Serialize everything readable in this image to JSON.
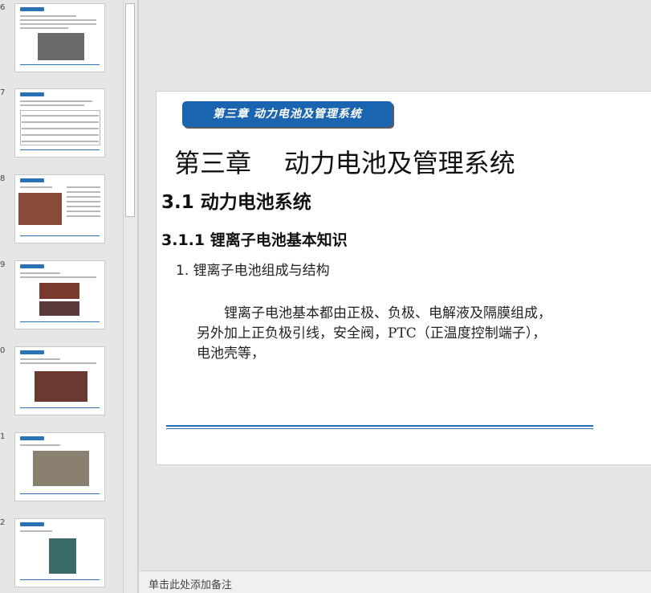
{
  "thumbnails": [
    {
      "number": "6"
    },
    {
      "number": "7"
    },
    {
      "number": "8"
    },
    {
      "number": "9"
    },
    {
      "number": "0"
    },
    {
      "number": "1"
    },
    {
      "number": "2"
    }
  ],
  "slide": {
    "chapter_banner": "第三章  动力电池及管理系统",
    "title": "第三章    动力电池及管理系统",
    "section": "3.1 动力电池系统",
    "subsection": "3.1.1 锂离子电池基本知识",
    "list_item": "1. 锂离子电池组成与结构",
    "body": "锂离子电池基本都由正极、负极、电解液及隔膜组成，另外加上正负极引线，安全阀，PTC（正温度控制端子），电池壳等，"
  },
  "notes": {
    "placeholder": "单击此处添加备注"
  },
  "colors": {
    "accent": "#1b64b0",
    "rule": "#1f6dbd"
  }
}
